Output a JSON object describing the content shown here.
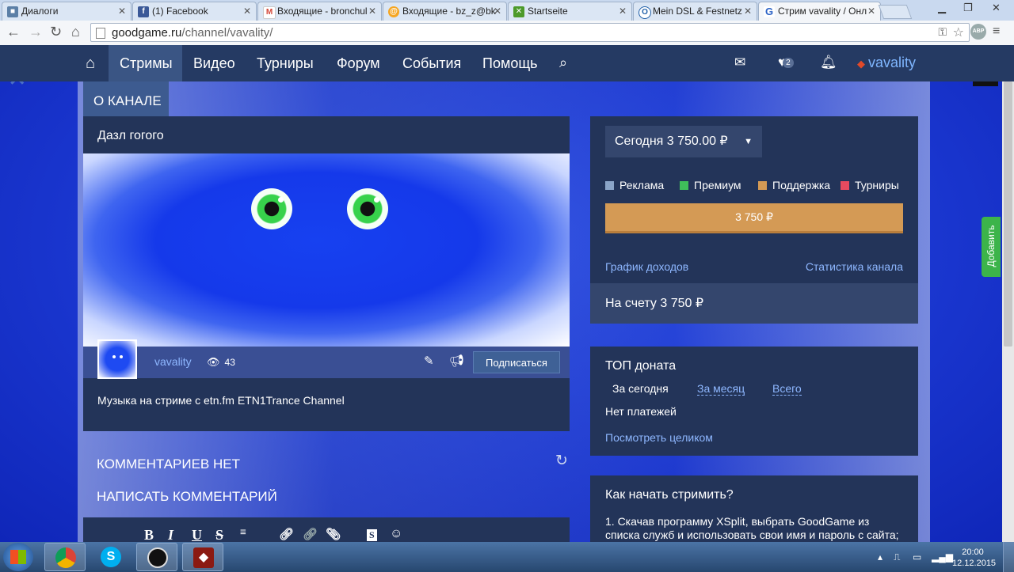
{
  "browser": {
    "tabs": [
      {
        "title": "Диалоги",
        "icon": "vk-icon",
        "color": "#5b7fa6"
      },
      {
        "title": "(1) Facebook",
        "icon": "facebook-icon",
        "color": "#3b5998"
      },
      {
        "title": "Входящие - bronchul",
        "icon": "gmail-icon",
        "color": "#d44638"
      },
      {
        "title": "Входящие - bz_z@bk",
        "icon": "mailru-icon",
        "color": "#f5a623"
      },
      {
        "title": "Startseite",
        "icon": "startseite-icon",
        "color": "#4c9a2a"
      },
      {
        "title": "Mein DSL & Festnetz",
        "icon": "telekom-icon",
        "color": "#1f5fa8"
      },
      {
        "title": "Стрим vavality / Онл",
        "icon": "goodgame-icon",
        "color": "#2b62c6"
      }
    ],
    "url_domain": "goodgame.ru",
    "url_path": "/channel/vavality/",
    "abp_label": "ABP"
  },
  "nav": {
    "items": [
      {
        "label": "Стримы",
        "active": true
      },
      {
        "label": "Видео",
        "active": false
      },
      {
        "label": "Турниры",
        "active": false
      },
      {
        "label": "Форум",
        "active": false
      },
      {
        "label": "События",
        "active": false
      },
      {
        "label": "Помощь",
        "active": false
      }
    ],
    "notifications_count": "2",
    "username": "vavality"
  },
  "about": {
    "tab_label": "О КАНАЛЕ",
    "title": "Дазл гогого",
    "username": "vavality",
    "views": "43",
    "subscribe_label": "Подписаться",
    "description": "Музыка на стриме с etn.fm ETN1Trance Channel"
  },
  "comments": {
    "none_label": "КОММЕНТАРИЕВ НЕТ",
    "write_label": "НАПИСАТЬ КОММЕНТАРИЙ",
    "toolbar": [
      "B",
      "I",
      "U",
      "S"
    ]
  },
  "money": {
    "today_label": "Сегодня 3 750.00 ₽",
    "legend": [
      {
        "label": "Реклама",
        "color": "#8aa4c8"
      },
      {
        "label": "Премиум",
        "color": "#3fbf5a"
      },
      {
        "label": "Поддержка",
        "color": "#d49a55"
      },
      {
        "label": "Турниры",
        "color": "#e84a5f"
      }
    ],
    "bar_label": "3 750 ₽",
    "income_chart_link": "График доходов",
    "channel_stats_link": "Статистика канала",
    "balance_label": "На счету 3 750 ₽"
  },
  "top_donate": {
    "title": "ТОП доната",
    "tabs": [
      {
        "label": "За сегодня",
        "active": true
      },
      {
        "label": "За месяц",
        "active": false
      },
      {
        "label": "Всего",
        "active": false
      }
    ],
    "empty_label": "Нет платежей",
    "view_all": "Посмотреть целиком"
  },
  "howto": {
    "title": "Как начать стримить?",
    "text": "1. Скачав программу XSplit, выбрать GoodGame из списка служб и использовать свои имя и пароль с сайта;"
  },
  "sidebar_add": "Добавить",
  "taskbar": {
    "time": "20:00",
    "date": "12.12.2015"
  }
}
